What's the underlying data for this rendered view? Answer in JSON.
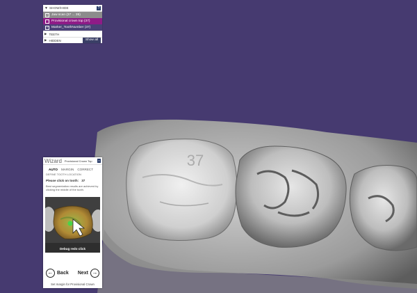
{
  "showhide": {
    "title": "SHOW/HIDE",
    "help": "?",
    "items": [
      {
        "label": "Jaw scan (37 ... 35)"
      },
      {
        "label": "Provisional crown top (37)"
      },
      {
        "label": "Marker_ToothNumber (37)"
      }
    ],
    "teeth_label": "TEETH",
    "hidden_label": "HIDDEN",
    "show_all": "Show all"
  },
  "scene": {
    "tooth_number": "37",
    "background_color": "#463a70"
  },
  "wizard": {
    "title": "Wizard",
    "subtitle": "Provisional Crown Top",
    "close": "x",
    "tabs": [
      "AUTO",
      "MARGIN",
      "CORRECT"
    ],
    "define": "DEFINE TOOTH LOCATION",
    "click_prompt": "Please click on tooth:",
    "click_tooth": "37",
    "info": "Best segmentation results are achieved by clicking the middle of the tooth.",
    "preview_caption": "Debug redo click",
    "back": "Back",
    "next": "Next",
    "footer": "Set margin for Provisional Crown"
  }
}
